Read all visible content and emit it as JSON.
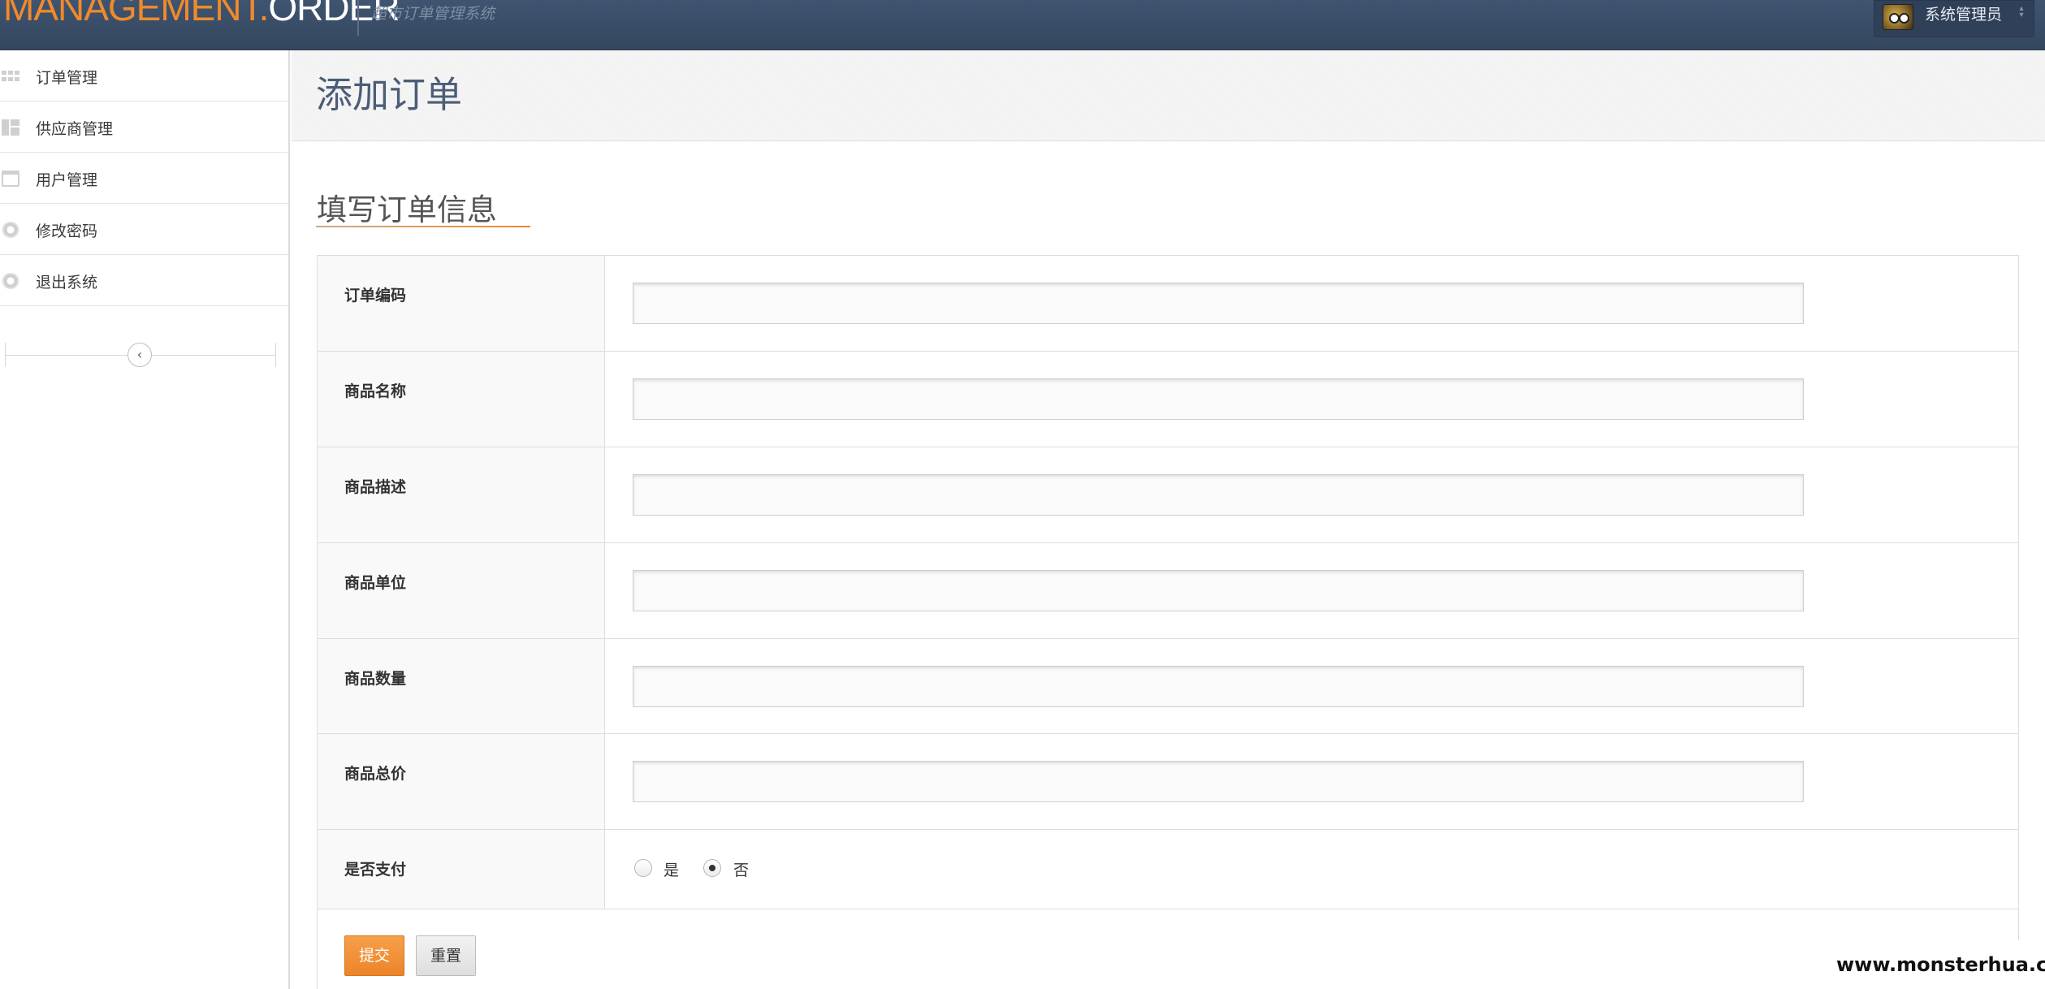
{
  "header": {
    "logo_part1": "MANAGEMENT.",
    "logo_part2": "ORDER",
    "subtitle": "超市订单管理系统",
    "user_name": "系统管理员",
    "user_caret": "⌃⌄"
  },
  "sidebar": {
    "items": [
      {
        "label": "订单管理",
        "icon": "grid-icon"
      },
      {
        "label": "供应商管理",
        "icon": "dashboard-icon"
      },
      {
        "label": "用户管理",
        "icon": "calendar-icon"
      },
      {
        "label": "修改密码",
        "icon": "lifebuoy-icon"
      },
      {
        "label": "退出系统",
        "icon": "lifebuoy-icon"
      }
    ],
    "collapse_glyph": "‹"
  },
  "page": {
    "title": "添加订单",
    "section_title": "填写订单信息"
  },
  "form": {
    "fields": [
      {
        "label": "订单编码",
        "value": ""
      },
      {
        "label": "商品名称",
        "value": ""
      },
      {
        "label": "商品描述",
        "value": ""
      },
      {
        "label": "商品单位",
        "value": ""
      },
      {
        "label": "商品数量",
        "value": ""
      },
      {
        "label": "商品总价",
        "value": ""
      }
    ],
    "paid": {
      "label": "是否支付",
      "options": [
        {
          "label": "是",
          "checked": false
        },
        {
          "label": "否",
          "checked": true
        }
      ]
    },
    "submit_label": "提交",
    "reset_label": "重置"
  },
  "watermark": "www.monsterhua.com",
  "colors": {
    "header_bg": "#3a4e69",
    "accent_orange": "#f08a2b",
    "title_color": "#4b5d77"
  }
}
